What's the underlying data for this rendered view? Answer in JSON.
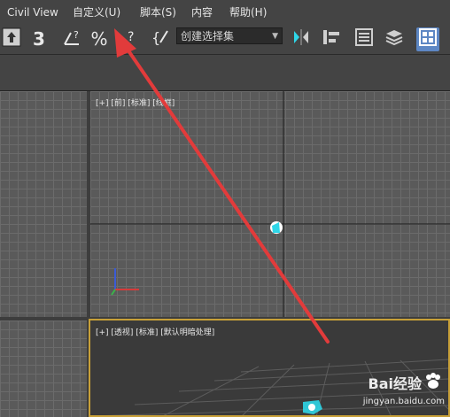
{
  "menu": {
    "items": [
      "Civil View",
      "自定义(U)",
      "脚本(S)",
      "内容",
      "帮助(H)"
    ]
  },
  "toolbar": {
    "selection_set": "创建选择集",
    "snap_toggle": "3",
    "percent_snap": "%"
  },
  "viewports": {
    "front_label": "[+] [前] [标准] [线框]",
    "perspective_label": "[+] [透视] [标准] [默认明暗处理]"
  },
  "watermark": {
    "brand": "Bai经验",
    "url": "jingyan.baidu.com"
  },
  "colors": {
    "annotation_arrow": "#e23b3b",
    "active_viewport_border": "#c8a038",
    "gizmo_cyan": "#2fd6e8"
  }
}
